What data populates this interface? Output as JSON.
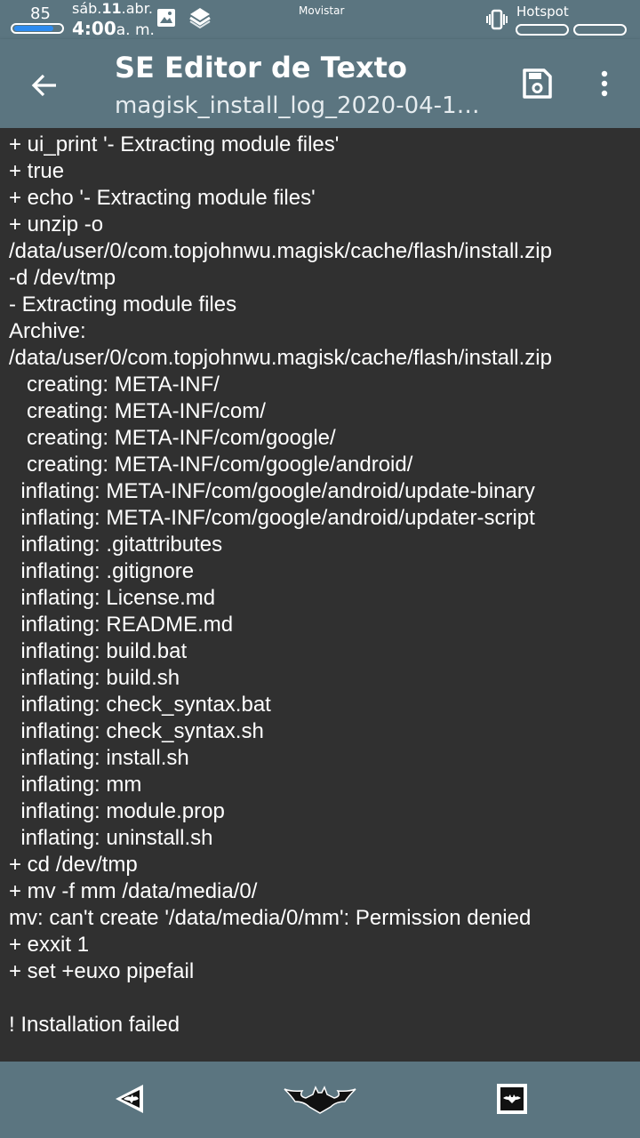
{
  "status_bar": {
    "battery_level": "85",
    "battery_fraction": 0.85,
    "date_prefix": "sáb.",
    "date_day": "11",
    "date_suffix": ".abr.",
    "time": "4:00",
    "time_suffix": "a. m.",
    "carrier": "Movistar",
    "hotspot_label": "Hotspot",
    "battery_color": "#2e8cf0"
  },
  "app_bar": {
    "title": "SE Editor de Texto",
    "subtitle": "magisk_install_log_2020-04-11…",
    "back_icon": "arrow-left-icon",
    "save_icon": "save-icon",
    "more_icon": "more-vert-icon",
    "background": "#5b7580"
  },
  "editor": {
    "background": "#303030",
    "text_color": "#ffffff",
    "lines": [
      "+ ui_print '- Extracting module files'",
      "+ true",
      "+ echo '- Extracting module files'",
      "+ unzip -o",
      "/data/user/0/com.topjohnwu.magisk/cache/flash/install.zip",
      "-d /dev/tmp",
      "- Extracting module files",
      "Archive:",
      "/data/user/0/com.topjohnwu.magisk/cache/flash/install.zip",
      "   creating: META-INF/",
      "   creating: META-INF/com/",
      "   creating: META-INF/com/google/",
      "   creating: META-INF/com/google/android/",
      "  inflating: META-INF/com/google/android/update-binary",
      "  inflating: META-INF/com/google/android/updater-script",
      "  inflating: .gitattributes",
      "  inflating: .gitignore",
      "  inflating: License.md",
      "  inflating: README.md",
      "  inflating: build.bat",
      "  inflating: build.sh",
      "  inflating: check_syntax.bat",
      "  inflating: check_syntax.sh",
      "  inflating: install.sh",
      "  inflating: mm",
      "  inflating: module.prop",
      "  inflating: uninstall.sh",
      "+ cd /dev/tmp",
      "+ mv -f mm /data/media/0/",
      "mv: can't create '/data/media/0/mm': Permission denied",
      "+ exxit 1",
      "+ set +euxo pipefail",
      "",
      "! Installation failed"
    ]
  },
  "nav_bar": {
    "back_icon": "batman-back-icon",
    "home_icon": "batman-home-icon",
    "recents_icon": "batman-recents-icon"
  }
}
